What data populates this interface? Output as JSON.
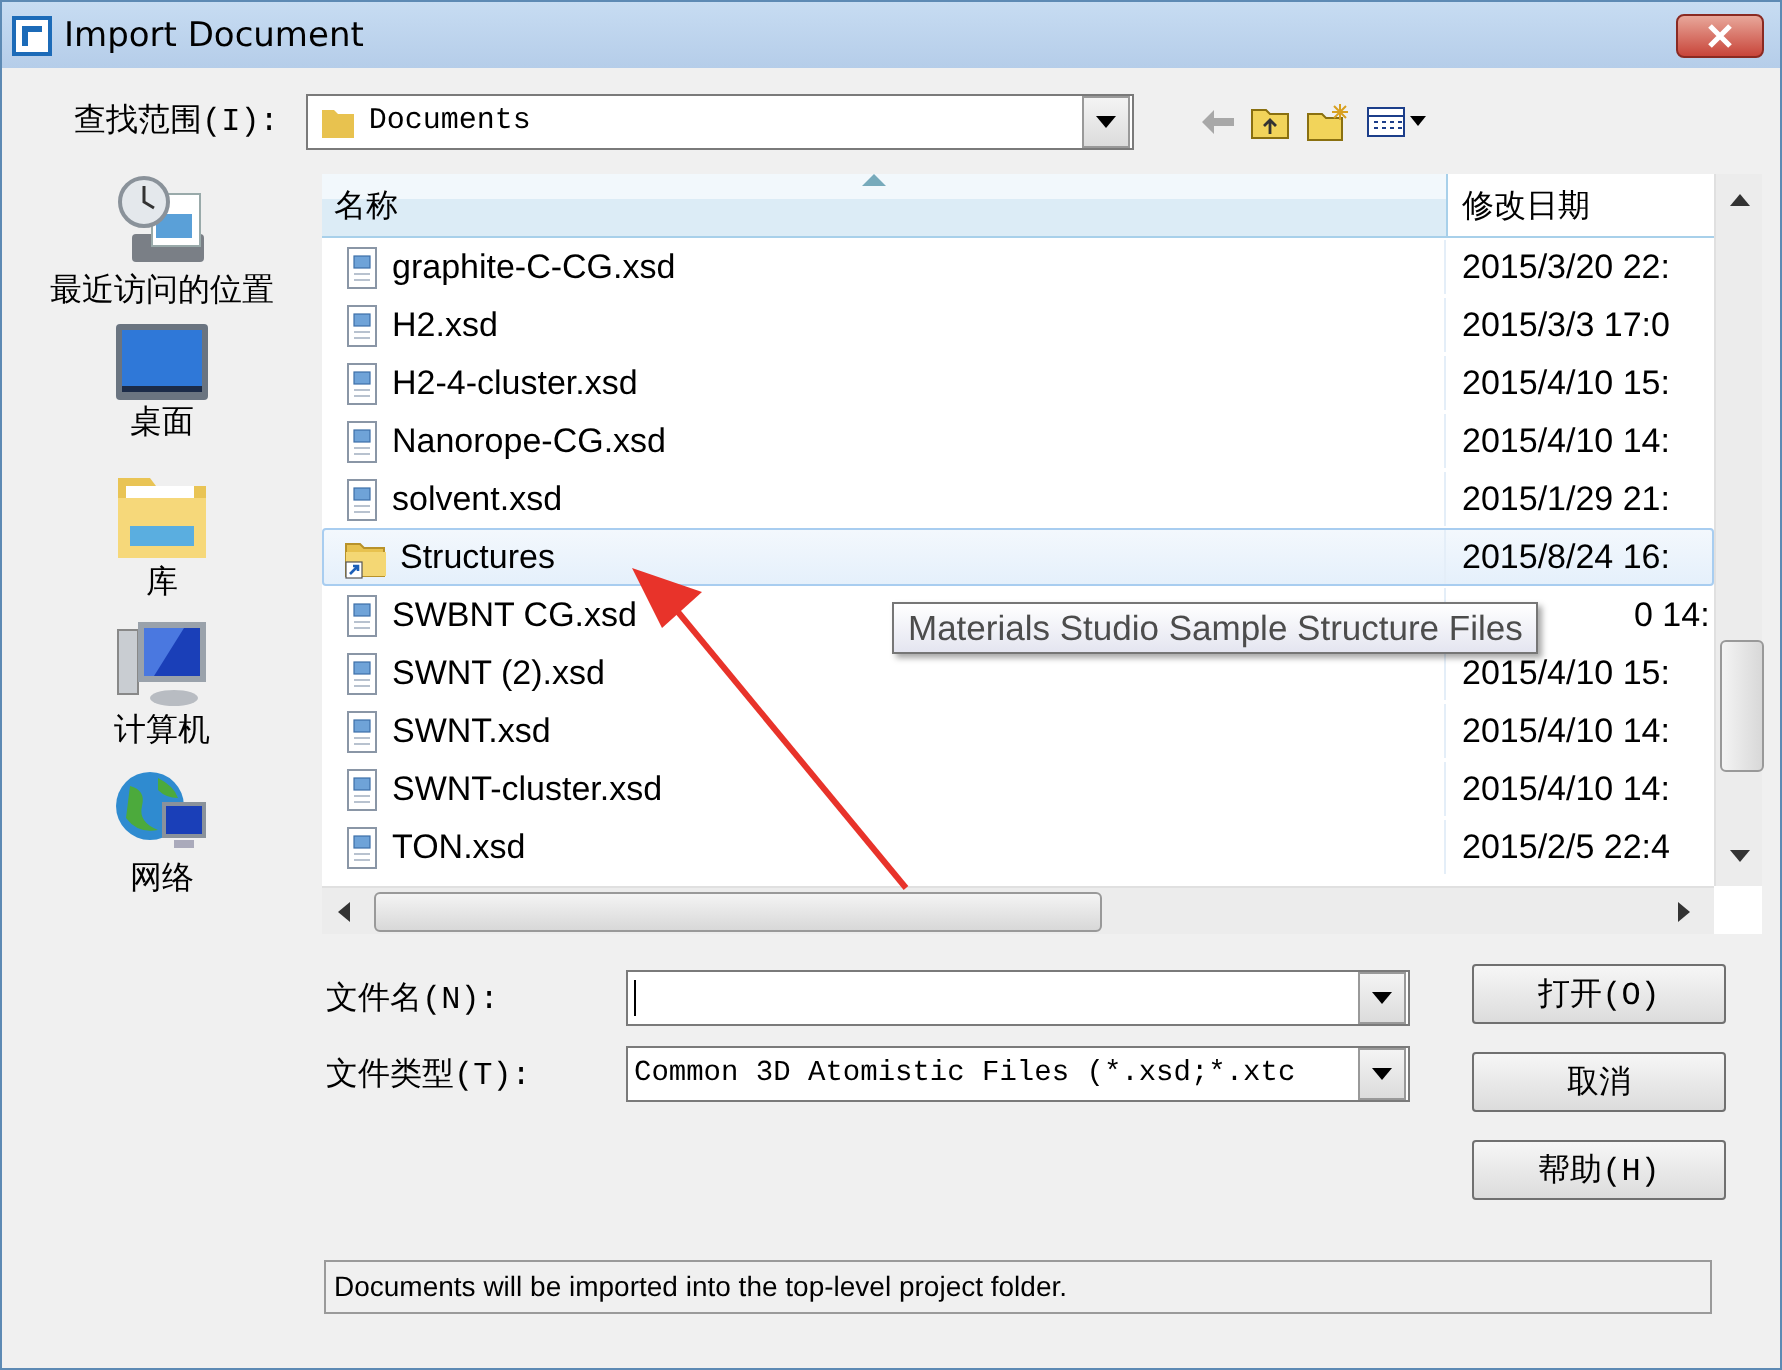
{
  "window": {
    "title": "Import Document"
  },
  "look_in": {
    "label": "查找范围(I):",
    "value": "Documents"
  },
  "places": [
    {
      "kind": "recent",
      "label": "最近访问的位置"
    },
    {
      "kind": "desktop",
      "label": "桌面"
    },
    {
      "kind": "library",
      "label": "库"
    },
    {
      "kind": "computer",
      "label": "计算机"
    },
    {
      "kind": "network",
      "label": "网络"
    }
  ],
  "table": {
    "columns": [
      "名称",
      "修改日期"
    ],
    "rows": [
      {
        "kind": "file",
        "name": "graphite-C-CG.xsd",
        "date": "2015/3/20 22:",
        "selected": false
      },
      {
        "kind": "file",
        "name": "H2.xsd",
        "date": "2015/3/3 17:0",
        "selected": false
      },
      {
        "kind": "file",
        "name": "H2-4-cluster.xsd",
        "date": "2015/4/10 15:",
        "selected": false
      },
      {
        "kind": "file",
        "name": "Nanorope-CG.xsd",
        "date": "2015/4/10 14:",
        "selected": false
      },
      {
        "kind": "file",
        "name": "solvent.xsd",
        "date": "2015/1/29 21:",
        "selected": false
      },
      {
        "kind": "folder",
        "name": "Structures",
        "date": "2015/8/24 16:",
        "selected": true
      },
      {
        "kind": "file",
        "name": "SWBNT CG.xsd",
        "date": "0 14:",
        "selected": false
      },
      {
        "kind": "file",
        "name": "SWNT (2).xsd",
        "date": "2015/4/10 15:",
        "selected": false
      },
      {
        "kind": "file",
        "name": "SWNT.xsd",
        "date": "2015/4/10 14:",
        "selected": false
      },
      {
        "kind": "file",
        "name": "SWNT-cluster.xsd",
        "date": "2015/4/10 14:",
        "selected": false
      },
      {
        "kind": "file",
        "name": "TON.xsd",
        "date": "2015/2/5 22:4",
        "selected": false
      }
    ]
  },
  "tooltip": "Materials Studio Sample Structure Files",
  "file_name": {
    "label": "文件名(N):"
  },
  "file_type": {
    "label": "文件类型(T):",
    "value": "Common 3D Atomistic Files (*.xsd;*.xtc"
  },
  "buttons": [
    "打开(O)",
    "取消",
    "帮助(H)"
  ],
  "status_bar": "Documents will be imported into the top-level project folder."
}
